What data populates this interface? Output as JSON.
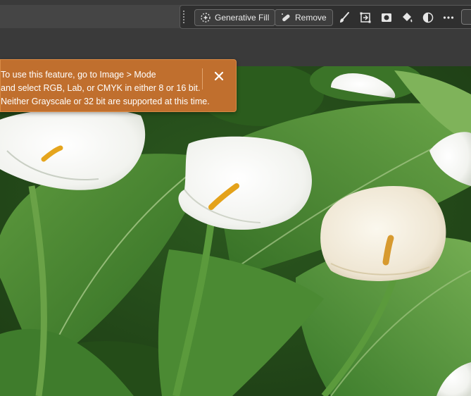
{
  "taskbar": {
    "generative_fill_label": "Generative Fill",
    "remove_label": "Remove",
    "icons": [
      "generative-fill-icon",
      "remove-bandage-icon",
      "brush-icon",
      "transform-icon",
      "mask-icon",
      "paint-bucket-icon",
      "adjustment-icon",
      "more-icon"
    ]
  },
  "toast": {
    "line1": "To use this feature, go to Image > Mode",
    "line2": "and select RGB, Lab, or CMYK in either 8 or 16 bit.",
    "line3": "Neither Grayscale or 32 bit are supported at this time.",
    "close_glyph": "✕",
    "background_color": "#c06f2e"
  },
  "colors": {
    "app_background": "#3b3b3b",
    "taskbar_background": "#2f2f2f",
    "leaf_green": "#3f7a2b",
    "flower_white": "#f4f4f0"
  }
}
